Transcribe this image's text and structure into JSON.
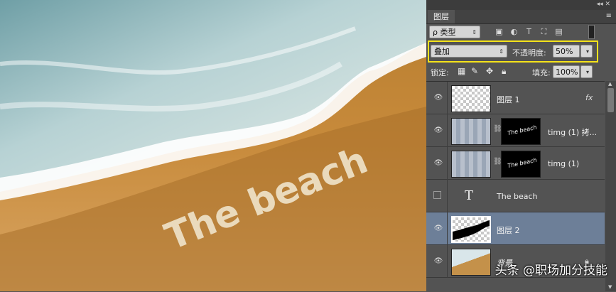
{
  "panel": {
    "tab_label": "图层",
    "menu_icon": "panel-menu-icon",
    "filter": {
      "kind_label": "ρ 类型",
      "icons": [
        "image-filter-icon",
        "adjustment-filter-icon",
        "type-filter-icon",
        "shape-filter-icon",
        "smart-object-filter-icon"
      ]
    },
    "blend_mode": "叠加",
    "opacity_label": "不透明度:",
    "opacity_value": "50%",
    "lock_label": "锁定:",
    "fill_label": "填充:",
    "fill_value": "100%"
  },
  "layers": [
    {
      "name": "图层 1",
      "visible": true,
      "fx": "fx",
      "thumb": "transparent"
    },
    {
      "name": "timg (1) 拷...",
      "visible": true,
      "thumb": "texture",
      "mask": "The beach"
    },
    {
      "name": "timg (1)",
      "visible": true,
      "thumb": "texture",
      "mask": "The beach"
    },
    {
      "name": "The beach",
      "visible": false,
      "type_glyph": "T"
    },
    {
      "name": "图层 2",
      "visible": true,
      "selected": true,
      "thumb": "black-shape"
    },
    {
      "name": "背景",
      "visible": true,
      "locked": true,
      "thumb": "beach"
    }
  ],
  "canvas": {
    "text": "The beach"
  },
  "watermark": "头条 @职场加分技能",
  "colors": {
    "highlight": "#f5e31a",
    "selected_layer": "#6d7f98",
    "panel_bg": "#535353"
  }
}
